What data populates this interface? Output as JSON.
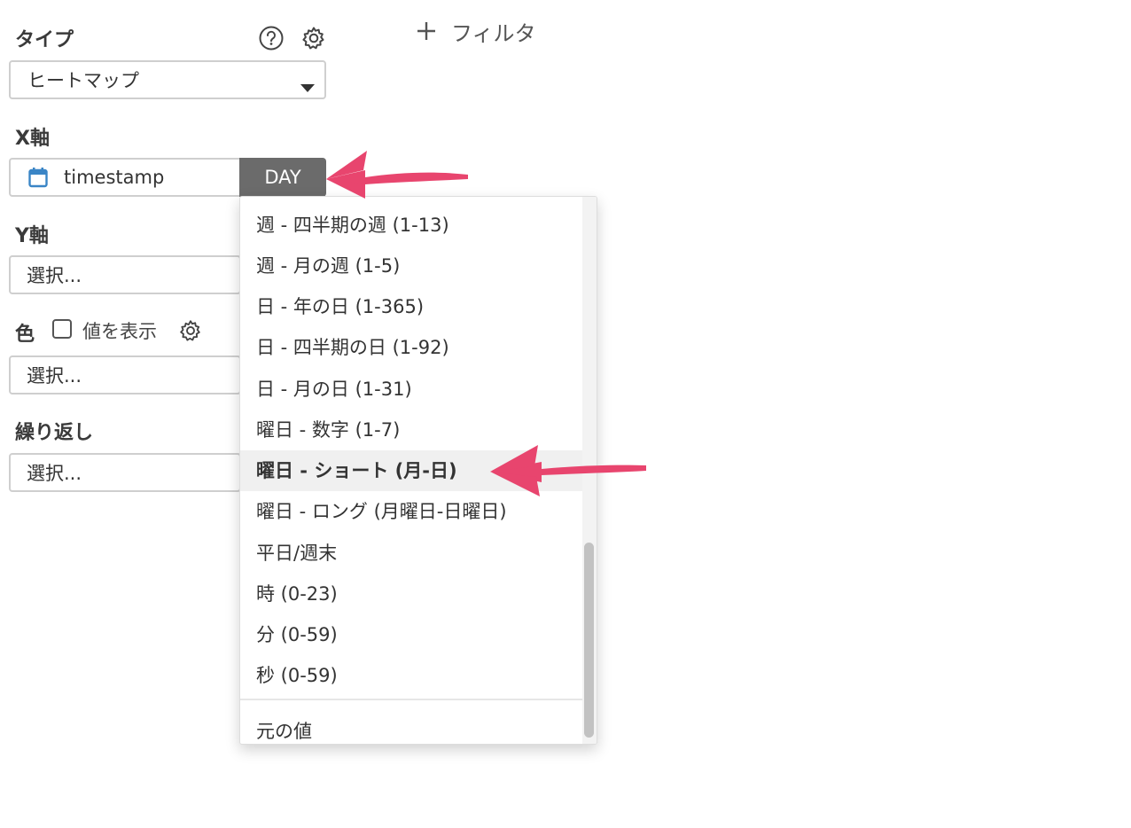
{
  "type_section": {
    "label": "タイプ",
    "selected": "ヒートマップ"
  },
  "add_filter": {
    "plus": "+",
    "label": "フィルタ"
  },
  "x_axis": {
    "label": "X軸",
    "field": "timestamp",
    "granularity": "DAY"
  },
  "y_axis": {
    "label": "Y軸",
    "placeholder": "選択..."
  },
  "color": {
    "label": "色",
    "show_values_label": "値を表示",
    "show_values_checked": false,
    "placeholder": "選択..."
  },
  "repeat": {
    "label": "繰り返し",
    "placeholder": "選択..."
  },
  "dropdown": {
    "items": [
      "週 - 四半期の週 (1-13)",
      "週 - 月の週 (1-5)",
      "日 - 年の日 (1-365)",
      "日 - 四半期の日 (1-92)",
      "日 - 月の日 (1-31)",
      "曜日 - 数字 (1-7)",
      "曜日 - ショート (月-日)",
      "曜日 - ロング (月曜日-日曜日)",
      "平日/週末",
      "時 (0-23)",
      "分 (0-59)",
      "秒 (0-59)"
    ],
    "selected_item": "曜日 - ショート (月-日)",
    "after_divider": "元の値"
  },
  "colors": {
    "annotation_arrow": "#e8456e",
    "granularity_button_bg": "#6b6b6b",
    "calendar_icon": "#3a85c6"
  },
  "icons": [
    "help-icon",
    "gear-icon",
    "plus-icon",
    "calendar-icon",
    "caret-down-icon"
  ]
}
